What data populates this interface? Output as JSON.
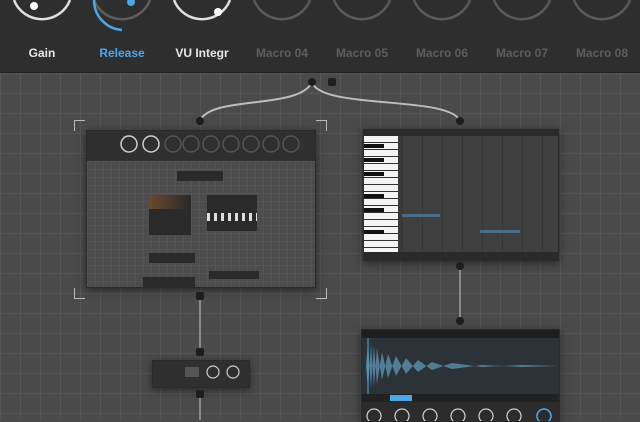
{
  "macros": [
    {
      "label": "Gain",
      "state": "active",
      "value": 0.15
    },
    {
      "label": "Release",
      "state": "accent",
      "value": 0.55
    },
    {
      "label": "VU Integr",
      "state": "active",
      "value": 0.75
    },
    {
      "label": "Macro 04",
      "state": "inactive",
      "value": 0
    },
    {
      "label": "Macro 05",
      "state": "inactive",
      "value": 0
    },
    {
      "label": "Macro 06",
      "state": "inactive",
      "value": 0
    },
    {
      "label": "Macro 07",
      "state": "inactive",
      "value": 0
    },
    {
      "label": "Macro 08",
      "state": "inactive",
      "value": 0
    }
  ],
  "colors": {
    "accent": "#4aa8e8",
    "active_label": "#e8e8e8",
    "inactive_label": "#5d5d5d",
    "background": "#4a4a4a",
    "bar": "#2e2e2e"
  },
  "icons": {
    "knob": "rotary-knob-icon",
    "port": "connection-port-icon"
  }
}
